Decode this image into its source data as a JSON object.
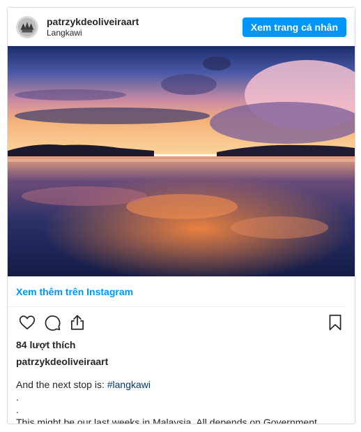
{
  "header": {
    "username": "patrzykdeoliveiraart",
    "location": "Langkawi",
    "view_profile_label": "Xem trang cá nhân"
  },
  "post": {
    "view_more_label": "Xem thêm trên Instagram",
    "likes_label": "84 lượt thích",
    "caption_username": "patrzykdeoliveiraart",
    "caption_lead": "And the next stop is: ",
    "caption_hashtag": "#langkawi",
    "caption_line2": ".",
    "caption_line3": ".",
    "caption_line4": "This might be our last weeks in Malaysia. All depends on Government"
  },
  "icons": {
    "like": "heart-icon",
    "comment": "comment-icon",
    "share": "share-icon",
    "save": "bookmark-icon"
  },
  "colors": {
    "accent": "#0095f6",
    "hashtag": "#00376b",
    "text": "#262626"
  }
}
